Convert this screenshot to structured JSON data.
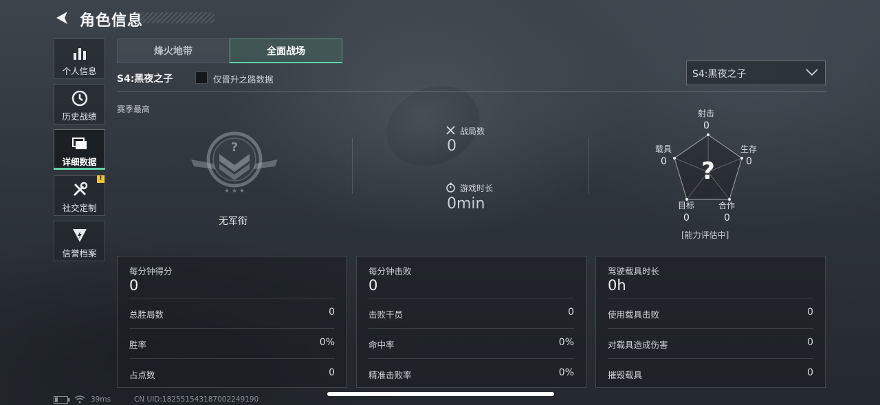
{
  "header": {
    "title": "角色信息"
  },
  "sidebar": {
    "items": [
      {
        "label": "个人信息",
        "icon": "bar-chart-icon"
      },
      {
        "label": "历史战绩",
        "icon": "history-clock-icon"
      },
      {
        "label": "详细数据",
        "icon": "stacked-cards-icon",
        "active": true
      },
      {
        "label": "社交定制",
        "icon": "tools-icon",
        "badge": "!"
      },
      {
        "label": "信誉档案",
        "icon": "shield-bolt-icon"
      }
    ]
  },
  "tabs": [
    {
      "label": "烽火地带",
      "active": false
    },
    {
      "label": "全面战场",
      "active": true
    }
  ],
  "filter": {
    "season_label": "S4:黑夜之子",
    "only_checkbox_label": "仅晋升之路数据",
    "only_checked": false,
    "season_select": "S4:黑夜之子"
  },
  "overview": {
    "section_label": "赛季最高",
    "rank_name": "无军衔",
    "rank_emblem_glyph": "?",
    "matches_label": "战局数",
    "matches_value": "0",
    "time_label": "游戏时长",
    "time_value": "0min"
  },
  "radar": {
    "center_glyph": "?",
    "status": "[能力评估中]",
    "axes": [
      {
        "label": "射击",
        "value": "0"
      },
      {
        "label": "生存",
        "value": "0"
      },
      {
        "label": "合作",
        "value": "0"
      },
      {
        "label": "目标",
        "value": "0"
      },
      {
        "label": "载具",
        "value": "0"
      }
    ]
  },
  "panels": [
    {
      "title": "每分钟得分",
      "value": "0",
      "rows": [
        {
          "label": "总胜局数",
          "value": "0"
        },
        {
          "label": "胜率",
          "value": "0%"
        },
        {
          "label": "占点数",
          "value": "0"
        }
      ]
    },
    {
      "title": "每分钟击败",
      "value": "0",
      "rows": [
        {
          "label": "击败干员",
          "value": "0"
        },
        {
          "label": "命中率",
          "value": "0%"
        },
        {
          "label": "精准击败率",
          "value": "0%"
        }
      ]
    },
    {
      "title": "驾驶载具时长",
      "value": "0h",
      "rows": [
        {
          "label": "使用载具击败",
          "value": "0"
        },
        {
          "label": "对载具造成伤害",
          "value": "0"
        },
        {
          "label": "摧毁载具",
          "value": "0"
        }
      ]
    }
  ],
  "status_bar": {
    "ping": "39ms",
    "uid": "CN UID:1825515431870022491​90"
  },
  "colors": {
    "accent": "#5fd3a6",
    "badge": "#f0c53c"
  }
}
